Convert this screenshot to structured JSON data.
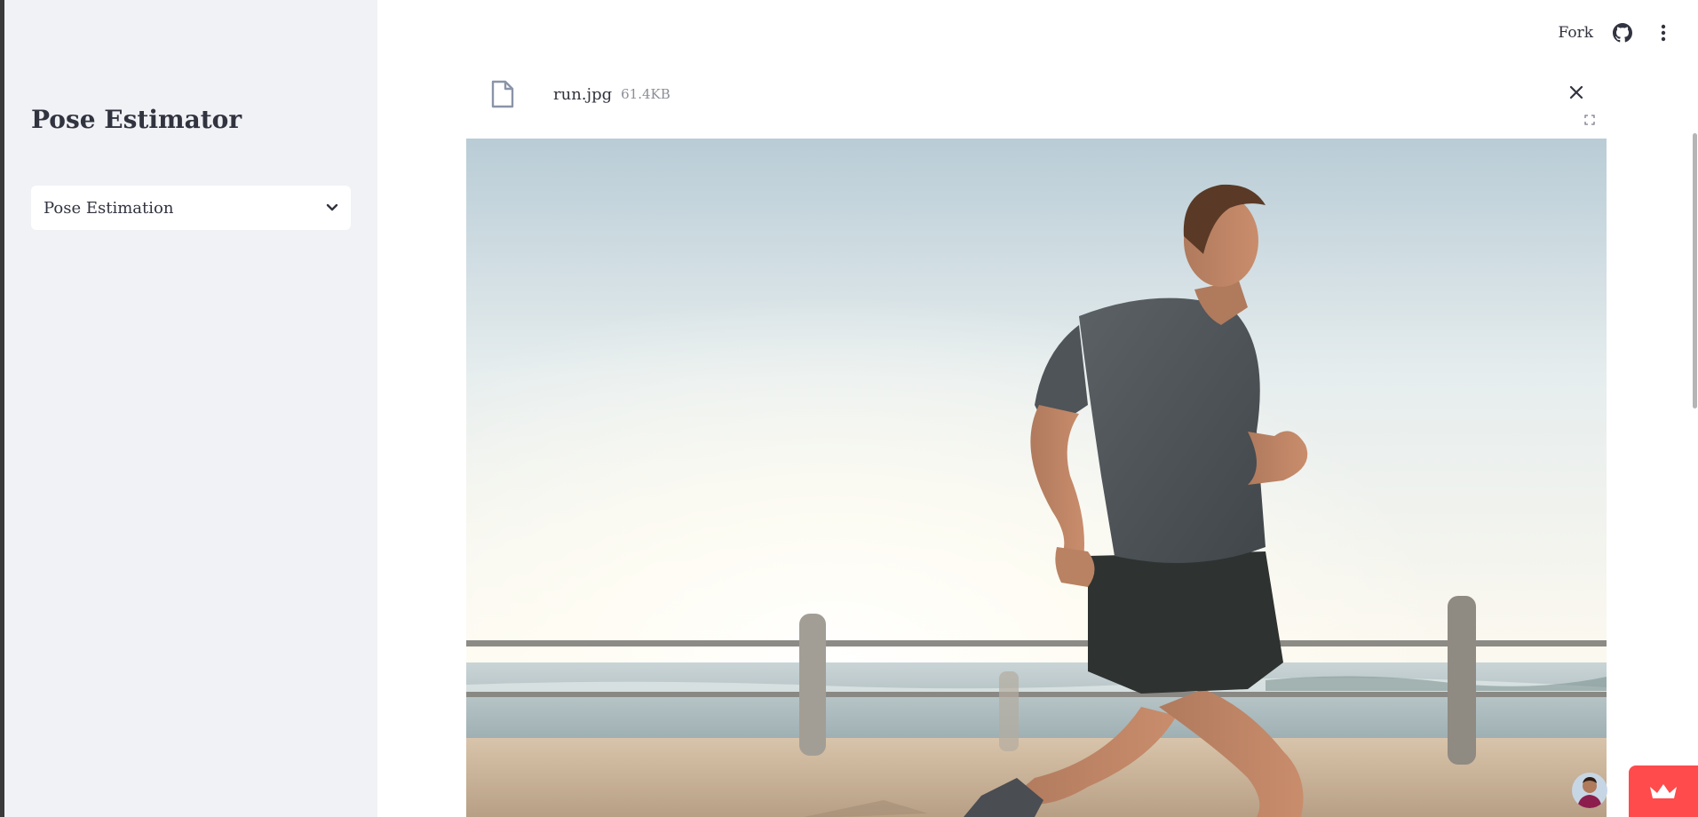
{
  "sidebar": {
    "title": "Pose Estimator",
    "select": {
      "value": "Pose Estimation",
      "icon": "chevron-down-icon"
    }
  },
  "toolbar": {
    "fork_label": "Fork",
    "github_icon": "github-icon",
    "menu_icon": "kebab-menu-icon"
  },
  "uploaded_file": {
    "name": "run.jpg",
    "size": "61.4KB",
    "icon": "file-icon",
    "remove_icon": "close-icon"
  },
  "image_viewer": {
    "fullscreen_icon": "fullscreen-icon",
    "image": "photo of a man running along a seaside boardwalk railing"
  },
  "colors": {
    "sidebar_bg": "#f0f2f6",
    "text": "#31333f",
    "muted_text": "#8b8e98",
    "accent": "#ff4b4b"
  }
}
